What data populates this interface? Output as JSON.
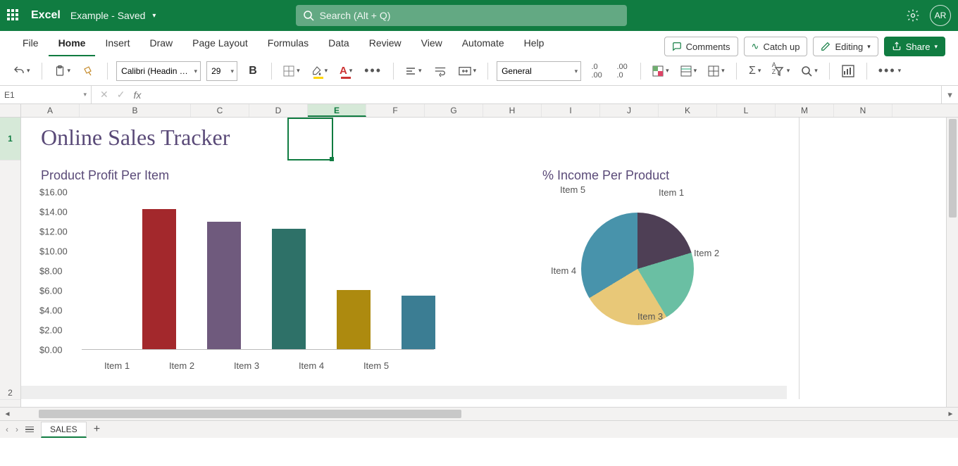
{
  "titlebar": {
    "app": "Excel",
    "doc": "Example  - Saved",
    "search_placeholder": "Search (Alt + Q)",
    "avatar": "AR"
  },
  "tabs": [
    "File",
    "Home",
    "Insert",
    "Draw",
    "Page Layout",
    "Formulas",
    "Data",
    "Review",
    "View",
    "Automate",
    "Help"
  ],
  "active_tab": "Home",
  "actions": {
    "comments": "Comments",
    "catchup": "Catch up",
    "editing": "Editing",
    "share": "Share"
  },
  "toolbar": {
    "font": "Calibri (Headin …",
    "size": "29",
    "number_format": "General"
  },
  "name_box": "E1",
  "formula": "",
  "columns": [
    "A",
    "B",
    "C",
    "D",
    "E",
    "F",
    "G",
    "H",
    "I",
    "J",
    "K",
    "L",
    "M",
    "N"
  ],
  "rows": [
    "1",
    "2"
  ],
  "selected_col": "E",
  "sheet_tab": "SALES",
  "titles": {
    "main": "Online Sales Tracker",
    "bar": "Product Profit Per Item",
    "pie": "% Income Per Product"
  },
  "chart_data": [
    {
      "type": "bar",
      "title": "Product Profit Per Item",
      "categories": [
        "Item 1",
        "Item 2",
        "Item 3",
        "Item 4",
        "Item 5"
      ],
      "values": [
        14.2,
        12.9,
        12.2,
        6.0,
        5.4
      ],
      "ylabel": "",
      "ylim": [
        0,
        16
      ],
      "yticks": [
        "$0.00",
        "$2.00",
        "$4.00",
        "$6.00",
        "$8.00",
        "$10.00",
        "$12.00",
        "$14.00",
        "$16.00"
      ],
      "colors": [
        "#a3282c",
        "#6f5a7d",
        "#2e7168",
        "#ad8a0f",
        "#3b7d93"
      ]
    },
    {
      "type": "pie",
      "title": "% Income Per Product",
      "categories": [
        "Item 1",
        "Item 2",
        "Item 3",
        "Item 4",
        "Item 5"
      ],
      "values": [
        16,
        21,
        21,
        25,
        17
      ],
      "colors": [
        "#d05a5a",
        "#4e3f55",
        "#6abfa3",
        "#e8c878",
        "#4893ab"
      ]
    }
  ]
}
